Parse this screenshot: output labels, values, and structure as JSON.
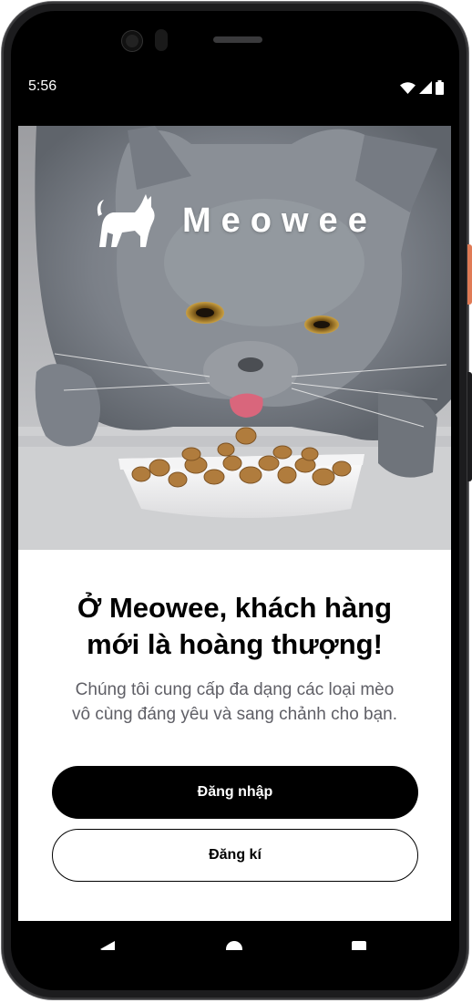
{
  "status_bar": {
    "time": "5:56",
    "icons": [
      "wifi-icon",
      "signal-icon",
      "battery-icon"
    ]
  },
  "hero": {
    "brand_name": "Meowee",
    "logo_icon": "cat-silhouette-icon",
    "image_description_icon": "cat-eating-food-photo"
  },
  "content": {
    "headline_line1": "Ở Meowee, khách hàng",
    "headline_line2": "mới là hoàng thượng!",
    "subtext_line1": "Chúng tôi cung cấp đa dạng các loại mèo",
    "subtext_line2": "vô cùng đáng yêu và sang chảnh cho bạn.",
    "login_label": "Đăng nhập",
    "register_label": "Đăng kí"
  },
  "nav_bar": {
    "icons": [
      "back-icon",
      "home-icon",
      "recent-apps-icon"
    ]
  },
  "colors": {
    "primary": "#000000",
    "background": "#ffffff",
    "subtext": "#5f5f66",
    "frame": "#1c1c1e",
    "side_button_accent": "#e07a55"
  }
}
